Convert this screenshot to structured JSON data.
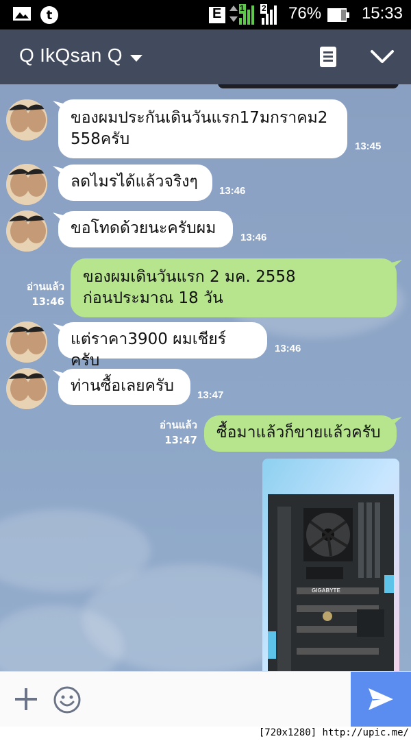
{
  "status_bar": {
    "network_type": "E",
    "sim1": "1",
    "sim2": "2",
    "battery_pct": "76%",
    "time": "15:33",
    "icons": [
      "gallery-icon",
      "tumblr-icon",
      "battery-icon"
    ]
  },
  "header": {
    "title": "Q IkQsan Q",
    "icons": [
      "dropdown-caret-icon",
      "notes-icon",
      "chevron-down-icon"
    ]
  },
  "messages": [
    {
      "side": "in",
      "text_lines": [
        "ของผมประกันเดินวันแรก17มกราคม2",
        "558ครับ"
      ],
      "time": "13:45"
    },
    {
      "side": "in",
      "text_lines": [
        "ลดไมรได้แล้วจริงๆ"
      ],
      "time": "13:46"
    },
    {
      "side": "in",
      "text_lines": [
        "ขอโทดด้วยนะครับผม"
      ],
      "time": "13:46"
    },
    {
      "side": "out",
      "text_lines": [
        "ของผมเดินวันแรก 2 มค. 2558",
        "ก่อนประมาณ 18 วัน"
      ],
      "read": "อ่านแล้ว",
      "time": "13:46"
    },
    {
      "side": "in",
      "text_lines": [
        "แต่ราคา3900 ผมเชียร์ครับ"
      ],
      "time": "13:46"
    },
    {
      "side": "in",
      "text_lines": [
        "ท่านซื้อเลยครับ"
      ],
      "time": "13:47"
    },
    {
      "side": "out",
      "text_lines": [
        "ซื้อมาแล้วก็ขายแล้วครับ"
      ],
      "read": "อ่านแล้ว",
      "time": "13:47"
    },
    {
      "side": "out",
      "type": "image",
      "label": "GIGABYTE"
    }
  ],
  "input": {
    "placeholder": "",
    "icons": [
      "plus-icon",
      "smiley-icon",
      "send-icon"
    ]
  },
  "watermark": "[720x1280] http://upic.me/",
  "colors": {
    "header_bg": "#424a5e",
    "incoming_bubble": "#ffffff",
    "outgoing_bubble": "#b6e58d",
    "send_button": "#5b8cf0",
    "chat_bg": "#8ea7c8"
  }
}
